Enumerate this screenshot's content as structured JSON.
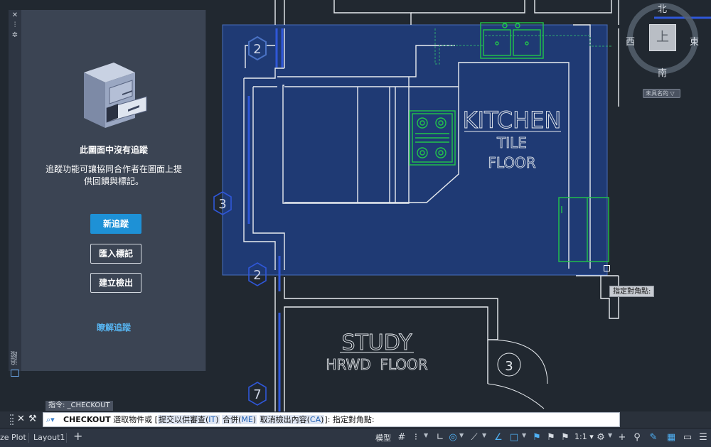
{
  "app": {
    "palette_strip": {
      "close_glyph": "✕",
      "pin_glyph": "⫶",
      "settings_glyph": "✲",
      "vertical_label": "追蹤"
    },
    "trace_panel": {
      "title": "此圖面中沒有追蹤",
      "description": "追蹤功能可讓協同合作者在圖面上提供回饋與標記。",
      "new_trace_label": "新追蹤",
      "import_markup_label": "匯入標記",
      "create_checkout_label": "建立檢出",
      "learn_link_label": "瞭解追蹤"
    },
    "drawing": {
      "room_labels": [
        {
          "text": "KITCHEN"
        },
        {
          "text": "TILE"
        },
        {
          "text": "FLOOR"
        },
        {
          "text": "STUDY"
        },
        {
          "text": "HRWD  FLOOR"
        }
      ],
      "tags": [
        "2",
        "3",
        "2",
        "3",
        "7"
      ],
      "selection_fill": "#1f3c78",
      "selection_border": "#4a72c4",
      "wall_color": "#e8ecf0",
      "fixture_color": "#22c64a"
    },
    "viewcube": {
      "north": "北",
      "south": "南",
      "east": "東",
      "west": "西",
      "face_label": "上",
      "ucs_label": "未具名的 ▽"
    },
    "cursor_tooltip": "指定對角點:",
    "command_history": "指令: _CHECKOUT",
    "command_line": {
      "close_glyph": "✕",
      "wrench_glyph": "🔧",
      "prompt_icon": "⌕▾",
      "command_name": "CHECKOUT",
      "text_before": " 選取物件或 [",
      "option1_label": "提交以供審查(",
      "option1_key": "IT",
      "option1_close": ")",
      "option2_label": "合併(",
      "option2_key": "ME",
      "option2_close": ")",
      "option3_label": "取消檢出內容(",
      "option3_key": "CA",
      "option3_close": ")",
      "text_after": "]: 指定對角點:"
    },
    "status_bar": {
      "tabs": [
        "ze Plot",
        "Layout1"
      ],
      "add_tab_glyph": "+",
      "model_label": "模型",
      "scale_label": "1:1 ▾",
      "icons": [
        "grid-icon",
        "snap-icon",
        "ortho-icon",
        "polar-icon",
        "osnap-icon",
        "otrack-icon",
        "lineweight-icon",
        "annotation-icon",
        "autoscale-icon",
        "workspace-gear-icon",
        "plus-icon",
        "isolate-icon",
        "hardware-accel-icon",
        "clean-screen-icon",
        "fullscreen-icon",
        "customize-menu-icon"
      ]
    }
  }
}
